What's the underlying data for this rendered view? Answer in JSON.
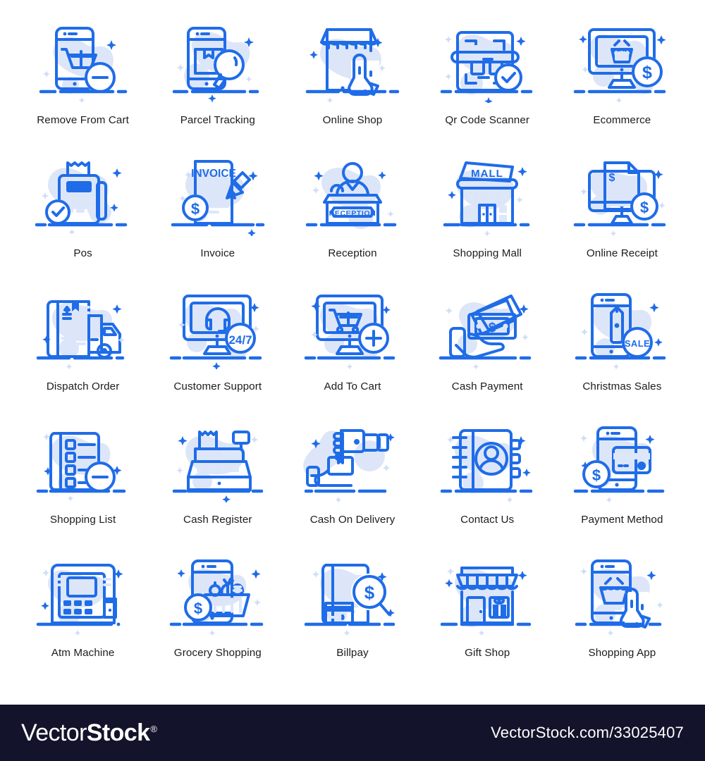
{
  "page": {
    "background": "#ffffff",
    "accent_color": "#1f6ce8",
    "blob_color": "#dde6f8",
    "caption_color": "#1c1c1c",
    "columns": 5,
    "rows": 5
  },
  "icons": [
    {
      "label": "Remove From Cart",
      "name": "remove-from-cart",
      "inline_text": ""
    },
    {
      "label": "Parcel Tracking",
      "name": "parcel-tracking",
      "inline_text": ""
    },
    {
      "label": "Online Shop",
      "name": "online-shop",
      "inline_text": ""
    },
    {
      "label": "Qr Code Scanner",
      "name": "qr-code-scanner",
      "inline_text": ""
    },
    {
      "label": "Ecommerce",
      "name": "ecommerce",
      "inline_text": "$"
    },
    {
      "label": "Pos",
      "name": "pos",
      "inline_text": ""
    },
    {
      "label": "Invoice",
      "name": "invoice",
      "inline_text": "INVOICE"
    },
    {
      "label": "Reception",
      "name": "reception",
      "inline_text": "RECEPTION"
    },
    {
      "label": "Shopping Mall",
      "name": "shopping-mall",
      "inline_text": "MALL"
    },
    {
      "label": "Online Receipt",
      "name": "online-receipt",
      "inline_text": "$"
    },
    {
      "label": "Dispatch Order",
      "name": "dispatch-order",
      "inline_text": ""
    },
    {
      "label": "Customer Support",
      "name": "customer-support",
      "inline_text": "24/7"
    },
    {
      "label": "Add To Cart",
      "name": "add-to-cart",
      "inline_text": ""
    },
    {
      "label": "Cash Payment",
      "name": "cash-payment",
      "inline_text": "$"
    },
    {
      "label": "Christmas Sales",
      "name": "christmas-sales",
      "inline_text": "SALE"
    },
    {
      "label": "Shopping List",
      "name": "shopping-list",
      "inline_text": ""
    },
    {
      "label": "Cash Register",
      "name": "cash-register",
      "inline_text": ""
    },
    {
      "label": "Cash On Delivery",
      "name": "cash-on-delivery",
      "inline_text": ""
    },
    {
      "label": "Contact Us",
      "name": "contact-us",
      "inline_text": ""
    },
    {
      "label": "Payment Method",
      "name": "payment-method",
      "inline_text": "$"
    },
    {
      "label": "Atm Machine",
      "name": "atm-machine",
      "inline_text": ""
    },
    {
      "label": "Grocery Shopping",
      "name": "grocery-shopping",
      "inline_text": "$"
    },
    {
      "label": "Billpay",
      "name": "billpay",
      "inline_text": "$"
    },
    {
      "label": "Gift Shop",
      "name": "gift-shop",
      "inline_text": ""
    },
    {
      "label": "Shopping App",
      "name": "shopping-app",
      "inline_text": ""
    }
  ],
  "icon_text": {
    "ecommerce_dollar": "$",
    "invoice_title": "INVOICE",
    "invoice_dollar": "$",
    "reception_sign": "RECEPTION",
    "mall_sign": "MALL",
    "receipt_dollar_doc": "$",
    "receipt_dollar_coin": "$",
    "support_badge": "24/7",
    "cash_payment_dollar": "$",
    "sale_badge": "SALE",
    "payment_method_dollar": "$",
    "grocery_dollar": "$",
    "billpay_dollar": "$"
  },
  "footer": {
    "logo_light": "Vector",
    "logo_bold": "Stock",
    "logo_reg": "®",
    "url": "VectorStock.com/33025407",
    "background": "#13142b"
  }
}
